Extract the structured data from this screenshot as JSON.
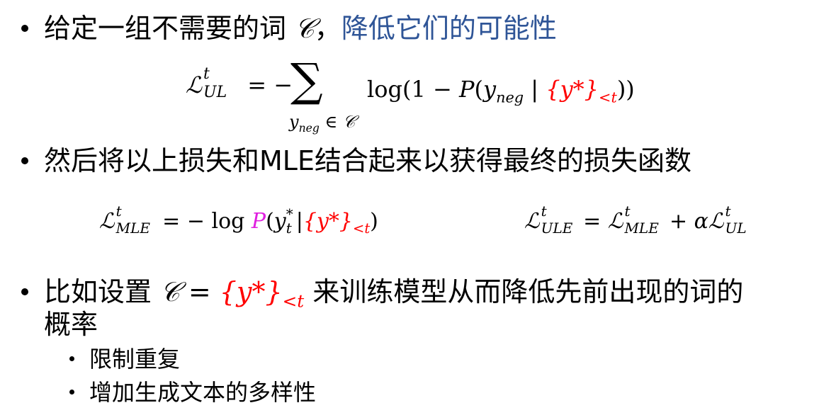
{
  "bullets": {
    "b1": {
      "text_part1": "给定一组不需要的词 ",
      "symbol_C": "𝒞",
      "text_part2": "，",
      "highlight": "降低它们的可能性"
    },
    "b2": {
      "text": "然后将以上损失和MLE结合起来以获得最终的损失函数"
    },
    "b3": {
      "text_part1": "比如设置 ",
      "symbol_C": "𝒞",
      "eq_sign": " = ",
      "set_expr": "{y*}",
      "set_sub": "<t",
      "text_part2": " 来训练模型从而降低先前出现的词的",
      "text_line2": "概率"
    }
  },
  "sub_items": [
    "限制重复",
    "增加生成文本的多样性"
  ],
  "equations": {
    "ul": {
      "lhs_L": "ℒ",
      "lhs_sup": "t",
      "lhs_sub": "UL",
      "equals": "= −",
      "sum": "∑",
      "sum_sub_var": "y",
      "sum_sub_var_sub": "neg",
      "sum_sub_in": " ∈ 𝒞",
      "log_part": "log(1 − ",
      "P": "P",
      "paren_open": "(",
      "y_neg": "y",
      "y_neg_sub": "neg",
      "bar": " | ",
      "cond_set": "{y*}",
      "cond_sub": "<t",
      "close": "))"
    },
    "mle": {
      "lhs_L": "ℒ",
      "lhs_sup": "t",
      "lhs_sub": "MLE",
      "equals": " = − log ",
      "P": "P",
      "arg_open": "(",
      "y_t": "y",
      "y_t_sup": "*",
      "y_t_sub": "t",
      "bar": "|",
      "cond_set": "{y*}",
      "cond_sub": "<t",
      "close": ")"
    },
    "ule": {
      "lhs_L": "ℒ",
      "lhs_sup": "t",
      "lhs_sub": "ULE",
      "equals": " = ",
      "rhs1_L": "ℒ",
      "rhs1_sup": "t",
      "rhs1_sub": "MLE",
      "plus": " + α",
      "rhs2_L": "ℒ",
      "rhs2_sup": "t",
      "rhs2_sub": "UL"
    }
  },
  "colors": {
    "highlight_blue": "#2f5597",
    "red": "#ff0000",
    "pink": "#e020e0"
  }
}
